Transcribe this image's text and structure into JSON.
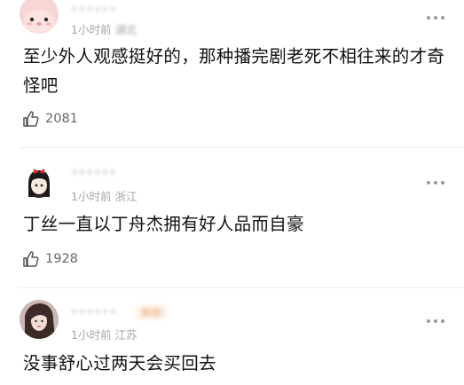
{
  "comments": [
    {
      "username": "••••••",
      "time": "1小时前",
      "location": "湖北",
      "text": "至少外人观感挺好的，那种播完剧老死不相往来的才奇怪吧",
      "likes": "2081",
      "avatar_icon": "pink-bear-avatar"
    },
    {
      "username": "••••••",
      "time": "1小时前",
      "location": "浙江",
      "text": "丁丝一直以丁舟杰拥有好人品而自豪",
      "likes": "1928",
      "avatar_icon": "cartoon-girl-avatar"
    },
    {
      "username": "••••••",
      "tag": "粉丝",
      "time": "1小时前",
      "location": "江苏",
      "text": "没事舒心过两天会买回去",
      "avatar_icon": "photo-girl-avatar"
    }
  ]
}
